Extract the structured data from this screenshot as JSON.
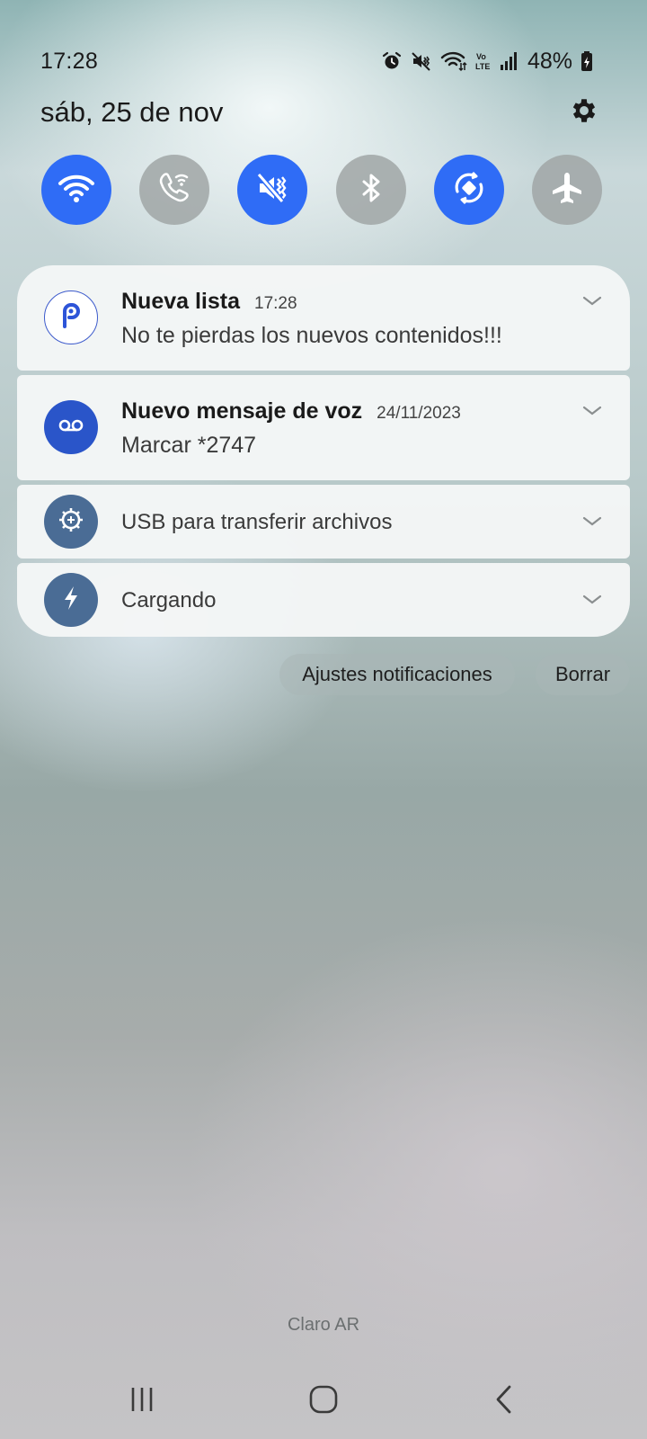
{
  "status_bar": {
    "time": "17:28",
    "battery": "48%",
    "icons": [
      "alarm-icon",
      "mute-icon",
      "wifi-icon",
      "volte-icon",
      "signal-icon",
      "battery-charging-icon"
    ]
  },
  "header": {
    "date": "sáb, 25 de nov",
    "settings_icon": "gear-icon"
  },
  "quick_settings": [
    {
      "name": "wifi",
      "icon": "wifi-icon",
      "state": "on"
    },
    {
      "name": "wifi-calling",
      "icon": "wifi-calling-icon",
      "state": "off"
    },
    {
      "name": "mute",
      "icon": "mute-icon",
      "state": "on"
    },
    {
      "name": "bluetooth",
      "icon": "bluetooth-icon",
      "state": "off"
    },
    {
      "name": "auto-rotate",
      "icon": "rotate-icon",
      "state": "on"
    },
    {
      "name": "airplane-mode",
      "icon": "airplane-icon",
      "state": "off"
    }
  ],
  "notifications": [
    {
      "title": "Nueva lista",
      "time": "17:28",
      "text": "No te pierdas los nuevos contenidos!!!",
      "icon": "pluto-p-icon"
    },
    {
      "title": "Nuevo mensaje de voz",
      "time": "24/11/2023",
      "text": "Marcar *2747",
      "icon": "voicemail-icon"
    },
    {
      "title": "USB para transferir archivos",
      "icon": "usb-settings-icon"
    },
    {
      "title": "Cargando",
      "icon": "charging-bolt-icon"
    }
  ],
  "actions": {
    "settings_label": "Ajustes notificaciones",
    "clear_label": "Borrar"
  },
  "carrier": "Claro AR",
  "colors": {
    "tile_on": "#2f6cf6",
    "tile_off": "#a0a6a6",
    "voicemail_icon_bg": "#2a55c9",
    "system_icon_bg": "#4a6c95"
  }
}
